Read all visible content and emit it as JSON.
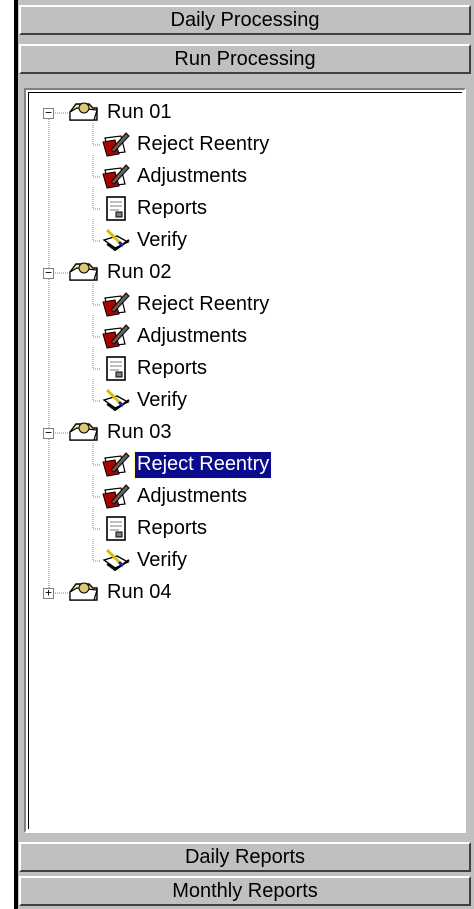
{
  "sections": {
    "daily_processing": "Daily Processing",
    "run_processing": "Run Processing",
    "daily_reports": "Daily Reports",
    "monthly_reports": "Monthly Reports"
  },
  "tree": {
    "runs": [
      {
        "label": "Run 01",
        "expanded": true,
        "children": [
          {
            "label": "Reject Reentry",
            "icon": "pen-paper-icon"
          },
          {
            "label": "Adjustments",
            "icon": "pen-paper-icon"
          },
          {
            "label": "Reports",
            "icon": "report-icon"
          },
          {
            "label": "Verify",
            "icon": "verify-icon"
          }
        ]
      },
      {
        "label": "Run 02",
        "expanded": true,
        "children": [
          {
            "label": "Reject Reentry",
            "icon": "pen-paper-icon"
          },
          {
            "label": "Adjustments",
            "icon": "pen-paper-icon"
          },
          {
            "label": "Reports",
            "icon": "report-icon"
          },
          {
            "label": "Verify",
            "icon": "verify-icon"
          }
        ]
      },
      {
        "label": "Run 03",
        "expanded": true,
        "children": [
          {
            "label": "Reject Reentry",
            "icon": "pen-paper-icon",
            "selected": true
          },
          {
            "label": "Adjustments",
            "icon": "pen-paper-icon"
          },
          {
            "label": "Reports",
            "icon": "report-icon"
          },
          {
            "label": "Verify",
            "icon": "verify-icon"
          }
        ]
      },
      {
        "label": "Run 04",
        "expanded": false,
        "children": []
      }
    ]
  },
  "colors": {
    "panel": "#c0c0c0",
    "selection": "#0a0a8c",
    "tree_lines": "#808080"
  }
}
